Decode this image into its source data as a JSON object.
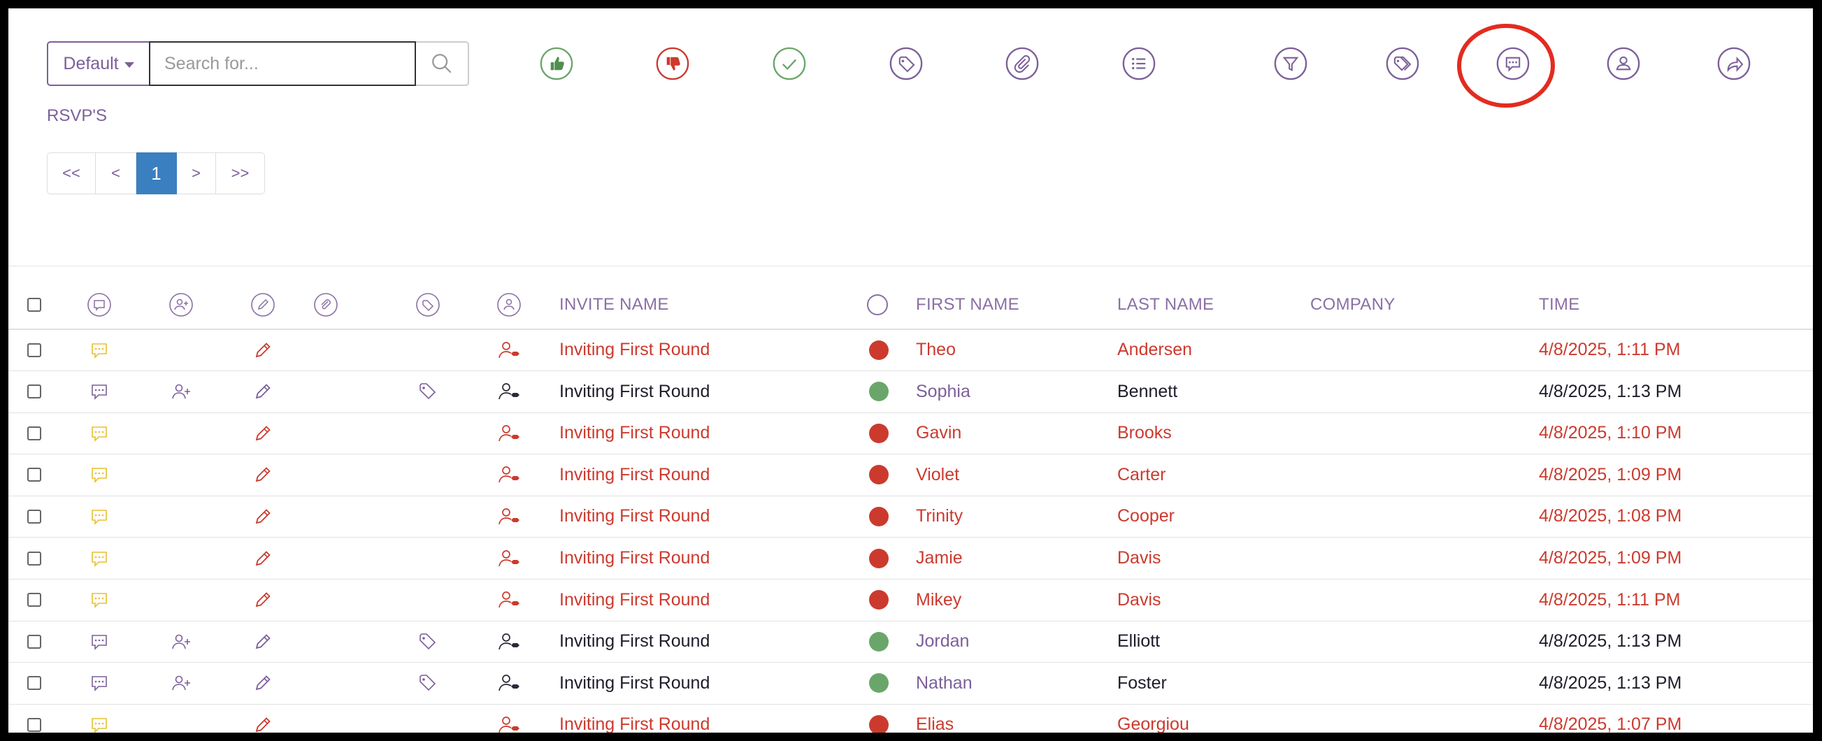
{
  "toolbar": {
    "default_label": "Default",
    "search_placeholder": "Search for...",
    "icons": [
      "thumbs-up-icon",
      "thumbs-down-icon",
      "check-icon",
      "tag-icon",
      "paperclip-icon",
      "list-icon",
      "filter-icon",
      "tags-icon",
      "comment-icon",
      "user-icon",
      "share-icon"
    ]
  },
  "section_label": "RSVP'S",
  "pager": {
    "first": "<<",
    "prev": "<",
    "current": "1",
    "next": ">",
    "last": ">>"
  },
  "columns": {
    "invite_name": "INVITE NAME",
    "first_name": "FIRST NAME",
    "last_name": "LAST NAME",
    "company": "COMPANY",
    "time": "TIME"
  },
  "colors": {
    "red": "#cc3a2e",
    "green": "#6aa66a",
    "purple": "#7c5f9a",
    "yellow": "#e8c02e",
    "highlight": "#e32b20"
  },
  "rows": [
    {
      "status": "declined",
      "invite": "Inviting First Round",
      "first": "Theo",
      "last": "Andersen",
      "company": "",
      "time": "4/8/2025, 1:11 PM"
    },
    {
      "status": "accepted",
      "invite": "Inviting First Round",
      "first": "Sophia",
      "last": "Bennett",
      "company": "",
      "time": "4/8/2025, 1:13 PM"
    },
    {
      "status": "declined",
      "invite": "Inviting First Round",
      "first": "Gavin",
      "last": "Brooks",
      "company": "",
      "time": "4/8/2025, 1:10 PM"
    },
    {
      "status": "declined",
      "invite": "Inviting First Round",
      "first": "Violet",
      "last": "Carter",
      "company": "",
      "time": "4/8/2025, 1:09 PM"
    },
    {
      "status": "declined",
      "invite": "Inviting First Round",
      "first": "Trinity",
      "last": "Cooper",
      "company": "",
      "time": "4/8/2025, 1:08 PM"
    },
    {
      "status": "declined",
      "invite": "Inviting First Round",
      "first": "Jamie",
      "last": "Davis",
      "company": "",
      "time": "4/8/2025, 1:09 PM"
    },
    {
      "status": "declined",
      "invite": "Inviting First Round",
      "first": "Mikey",
      "last": "Davis",
      "company": "",
      "time": "4/8/2025, 1:11 PM"
    },
    {
      "status": "accepted",
      "invite": "Inviting First Round",
      "first": "Jordan",
      "last": "Elliott",
      "company": "",
      "time": "4/8/2025, 1:13 PM"
    },
    {
      "status": "accepted",
      "invite": "Inviting First Round",
      "first": "Nathan",
      "last": "Foster",
      "company": "",
      "time": "4/8/2025, 1:13 PM"
    },
    {
      "status": "declined",
      "invite": "Inviting First Round",
      "first": "Elias",
      "last": "Georgiou",
      "company": "",
      "time": "4/8/2025, 1:07 PM"
    }
  ]
}
